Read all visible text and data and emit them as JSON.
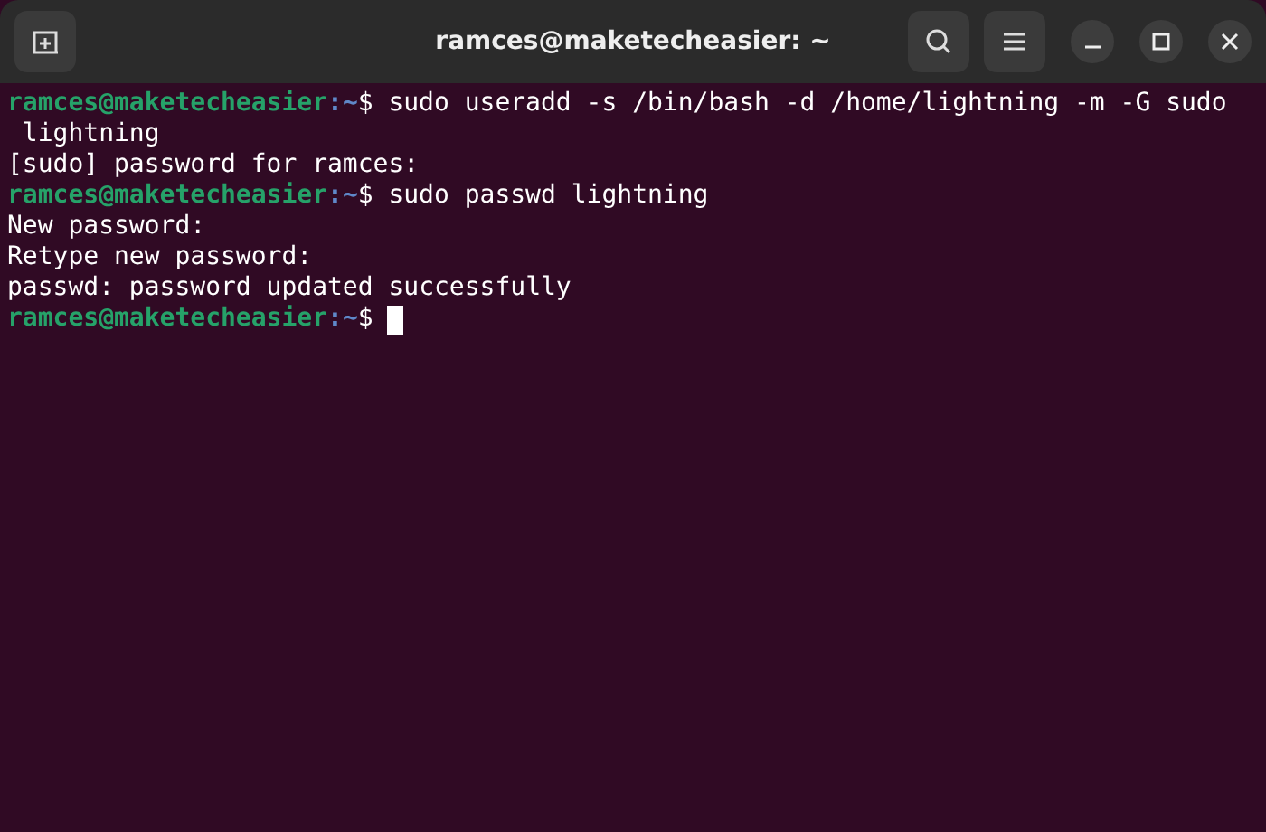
{
  "window": {
    "title": "ramces@maketecheasier: ~"
  },
  "terminal": {
    "lines": [
      {
        "kind": "prompt",
        "user": "ramces@maketecheasier",
        "path": ":~",
        "sign": "$",
        "command": "sudo useradd -s /bin/bash -d /home/lightning -m -G sudo"
      },
      {
        "kind": "output",
        "text": " lightning"
      },
      {
        "kind": "output",
        "text": "[sudo] password for ramces:"
      },
      {
        "kind": "prompt",
        "user": "ramces@maketecheasier",
        "path": ":~",
        "sign": "$",
        "command": "sudo passwd lightning"
      },
      {
        "kind": "output",
        "text": "New password:"
      },
      {
        "kind": "output",
        "text": "Retype new password:"
      },
      {
        "kind": "output",
        "text": "passwd: password updated successfully"
      },
      {
        "kind": "prompt",
        "user": "ramces@maketecheasier",
        "path": ":~",
        "sign": "$",
        "cursor": true
      }
    ]
  }
}
